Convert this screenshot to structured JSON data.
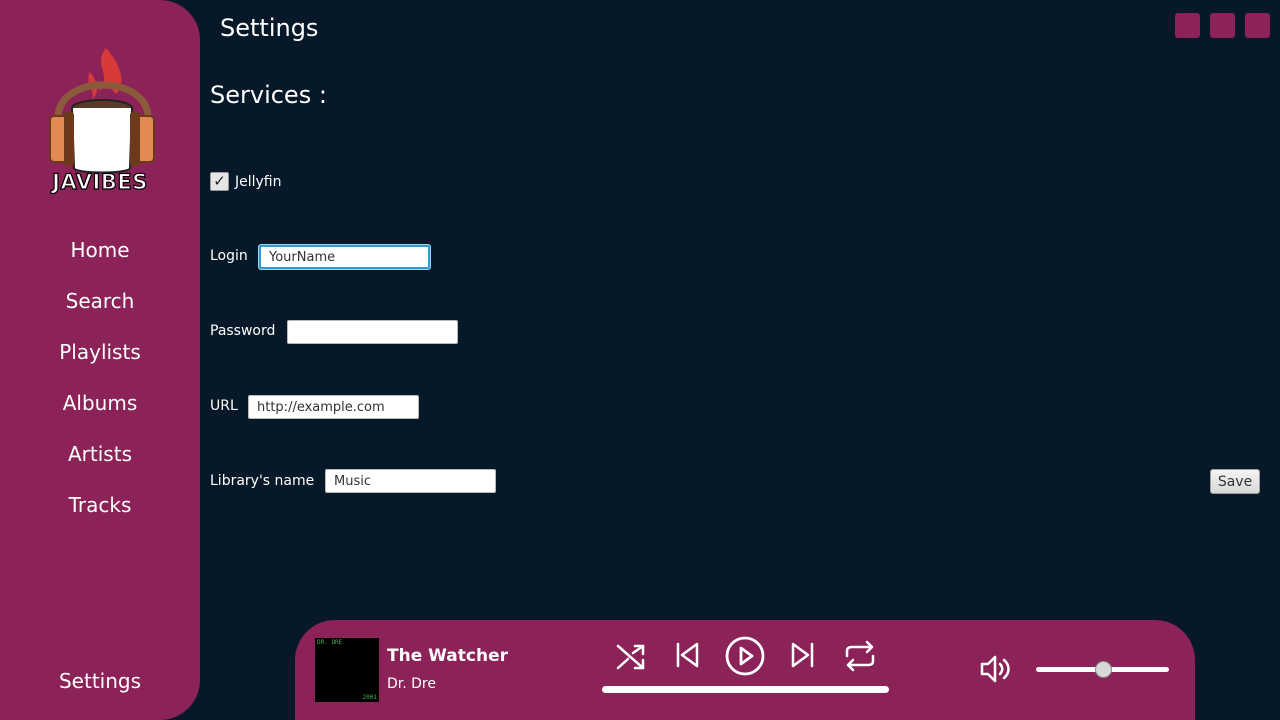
{
  "app": {
    "logo_text": "JAVIBES"
  },
  "sidebar": {
    "items": [
      {
        "label": "Home"
      },
      {
        "label": "Search"
      },
      {
        "label": "Playlists"
      },
      {
        "label": "Albums"
      },
      {
        "label": "Artists"
      },
      {
        "label": "Tracks"
      }
    ],
    "settings_label": "Settings"
  },
  "header": {
    "title": "Settings"
  },
  "services": {
    "title": "Services :",
    "jellyfin": {
      "label": "Jellyfin",
      "checked": true
    },
    "login": {
      "label": "Login",
      "value": "YourName"
    },
    "password": {
      "label": "Password",
      "value": ""
    },
    "url": {
      "label": "URL",
      "value": "http://example.com"
    },
    "library": {
      "label": "Library's name",
      "value": "Music"
    },
    "save_label": "Save"
  },
  "player": {
    "title": "The Watcher",
    "artist": "Dr. Dre",
    "cover": {
      "top_text": "DR. DRE",
      "bottom_text": "2001"
    },
    "volume_level": 0.5,
    "progress": 0
  },
  "colors": {
    "background": "#071828",
    "accent": "#8c2358",
    "text": "#ffffff",
    "focus": "#2f9bd3"
  },
  "icons": [
    "coffee-headphones-logo",
    "shuffle-icon",
    "previous-icon",
    "play-icon",
    "next-icon",
    "repeat-icon",
    "volume-icon",
    "checkmark-icon"
  ]
}
